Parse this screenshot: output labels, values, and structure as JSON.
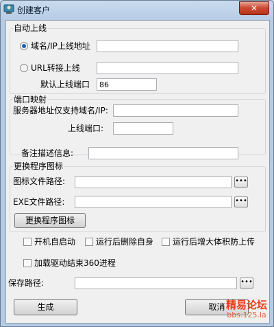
{
  "window": {
    "title": "创建客户",
    "close_glyph": "✕"
  },
  "auto_online": {
    "group_label": "自动上线",
    "domain_ip_label": "域名/IP上线地址",
    "domain_ip_value": "",
    "url_label": "URL转接上线",
    "url_value": "",
    "port_label": "默认上线端口",
    "port_value": "86",
    "selected_option": "domain_ip"
  },
  "port_mapping": {
    "group_label": "端口映射",
    "server_label": "服务器地址仅支持域名/IP:",
    "server_value": "",
    "port_label": "上线端口:",
    "port_value": ""
  },
  "remark": {
    "label": "备注描述信息:",
    "value": ""
  },
  "icon_change": {
    "group_label": "更换程序图标",
    "icon_path_label": "图标文件路径:",
    "icon_path_value": "",
    "browse_glyph": "•••",
    "exe_path_label": "EXE文件路径:",
    "exe_path_value": "",
    "change_button": "更换程序图标"
  },
  "options": {
    "autostart": "开机自启动",
    "delete_self": "运行后删除自身",
    "enlarge": "运行后增大体积防上传",
    "load_driver": "加载驱动结束360进程"
  },
  "save": {
    "label": "保存路径:",
    "value": ""
  },
  "buttons": {
    "generate": "生成",
    "cancel": "取消"
  },
  "watermark": {
    "title": "精易论坛",
    "url": "bbs.125.la"
  },
  "colors": {
    "titlebar": "#c8dcef",
    "client": "#f0f0f0",
    "close": "#cc4c36",
    "radio_dot": "#1b5fb8",
    "watermark": "#ee3a17"
  },
  "icons": {
    "app": "client-icon",
    "close": "close-icon",
    "browse": "ellipsis-icon"
  }
}
